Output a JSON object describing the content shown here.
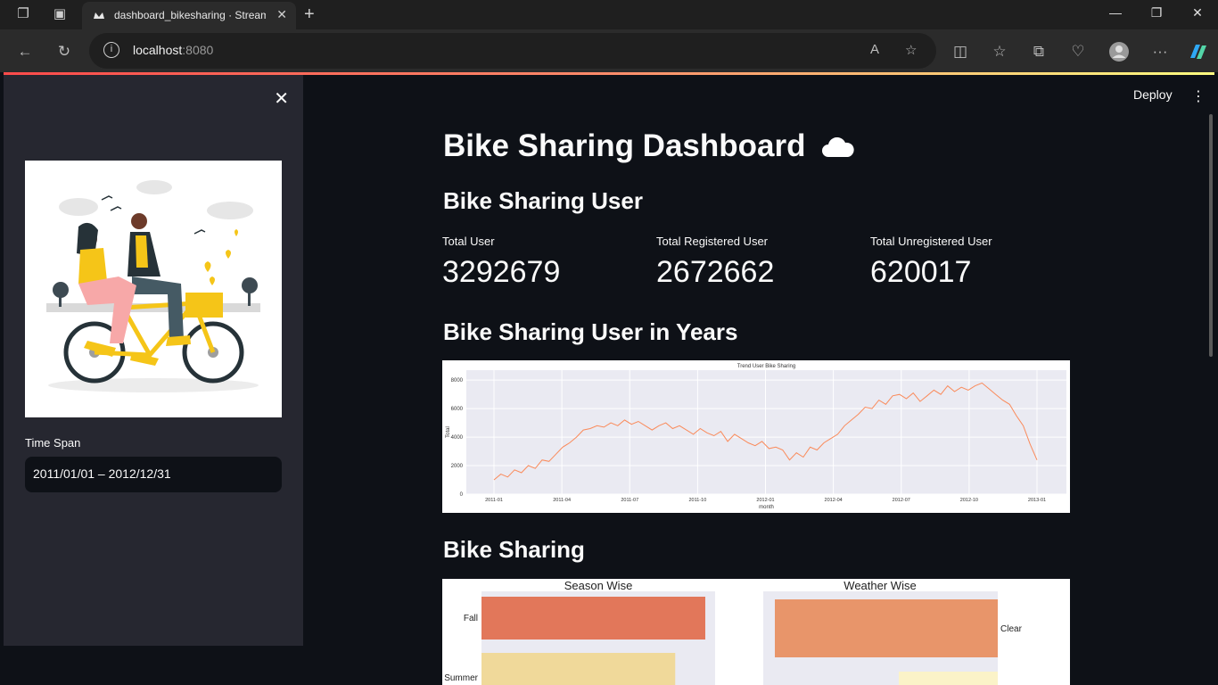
{
  "browser": {
    "tab_title": "dashboard_bikesharing · Streamlit",
    "url_host": "localhost",
    "url_port": ":8080"
  },
  "header": {
    "deploy_label": "Deploy"
  },
  "sidebar": {
    "time_span_label": "Time Span",
    "time_span_value": "2011/01/01 – 2012/12/31"
  },
  "main": {
    "title": "Bike Sharing Dashboard",
    "title_icon": "cloud-icon",
    "section_user": "Bike Sharing User",
    "metrics": [
      {
        "label": "Total User",
        "value": "3292679"
      },
      {
        "label": "Total Registered User",
        "value": "2672662"
      },
      {
        "label": "Total Unregistered User",
        "value": "620017"
      }
    ],
    "section_years": "Bike Sharing User in Years",
    "section_bike": "Bike Sharing"
  },
  "colors": {
    "accent": "#ff4b4b",
    "line": "#fa8a5a",
    "bar_fall": "#e2775a",
    "bar_summer": "#f0d99a",
    "bar_clear": "#e8956a"
  },
  "chart_data": [
    {
      "type": "line",
      "title": "Trend User Bike Sharing",
      "xlabel": "month",
      "ylabel": "Total",
      "x_ticks": [
        "2011-01",
        "2011-04",
        "2011-07",
        "2011-10",
        "2012-01",
        "2012-04",
        "2012-07",
        "2012-10",
        "2013-01"
      ],
      "y_ticks": [
        "0",
        "2000",
        "4000",
        "6000",
        "8000"
      ],
      "ylim": [
        0,
        8700
      ],
      "series": [
        {
          "values": [
            1000,
            1400,
            1200,
            1700,
            1500,
            2000,
            1800,
            2400,
            2300,
            2800,
            3300,
            3600,
            4000,
            4500,
            4600,
            4800,
            4700,
            5000,
            4800,
            5200,
            4900,
            5100,
            4800,
            4500,
            4800,
            5000,
            4600,
            4800,
            4500,
            4200,
            4600,
            4300,
            4100,
            4400,
            3700,
            4200,
            3900,
            3600,
            3400,
            3700,
            3200,
            3300,
            3100,
            2400,
            2900,
            2600,
            3300,
            3100,
            3600,
            3900,
            4200,
            4800,
            5200,
            5600,
            6100,
            6000,
            6600,
            6300,
            6900,
            7000,
            6700,
            7100,
            6500,
            6900,
            7300,
            7000,
            7600,
            7200,
            7500,
            7300,
            7600,
            7800,
            7400,
            7000,
            6600,
            6300,
            5500,
            4800,
            3500,
            2400
          ]
        }
      ]
    },
    {
      "type": "bar",
      "title": "Season Wise",
      "categories": [
        "Fall",
        "Summer"
      ],
      "values": [
        1061129,
        918589
      ]
    },
    {
      "type": "bar",
      "title": "Weather Wise",
      "categories": [
        "Clear"
      ],
      "values": [
        2257952
      ]
    }
  ]
}
